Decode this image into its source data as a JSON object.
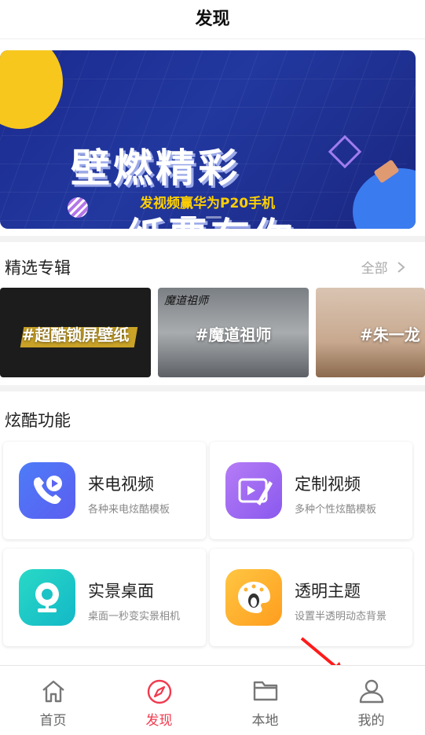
{
  "header": {
    "title": "发现"
  },
  "banner": {
    "headline_top": "壁燃精彩",
    "subline": "发视频赢华为P20手机",
    "headline_bottom": "纸要有你",
    "active_index": 0,
    "colors": {
      "bg": "#1b2a8f",
      "accent_yellow": "#f7c71d",
      "accent_blue": "#3a7bf0"
    }
  },
  "albums": {
    "title": "精选专辑",
    "more_label": "全部",
    "items": [
      {
        "label": "#超酷锁屏壁纸"
      },
      {
        "label": "#魔道祖师",
        "logo_text": "魔道祖师"
      },
      {
        "label": "#朱一龙"
      }
    ]
  },
  "features": {
    "title": "炫酷功能",
    "items": [
      {
        "name": "来电视频",
        "desc": "各种来电炫酷模板",
        "icon": "phone-play-icon"
      },
      {
        "name": "定制视频",
        "desc": "多种个性炫酷模板",
        "icon": "pencil-video-icon"
      },
      {
        "name": "实景桌面",
        "desc": "桌面一秒变实景相机",
        "icon": "webcam-icon"
      },
      {
        "name": "透明主题",
        "desc": "设置半透明动态背景",
        "icon": "penguin-palette-icon"
      }
    ]
  },
  "tabbar": {
    "items": [
      {
        "label": "首页",
        "icon": "home-icon"
      },
      {
        "label": "发现",
        "icon": "compass-icon",
        "active": true
      },
      {
        "label": "本地",
        "icon": "folder-icon"
      },
      {
        "label": "我的",
        "icon": "user-icon"
      }
    ],
    "active_color": "#f03b4f"
  }
}
